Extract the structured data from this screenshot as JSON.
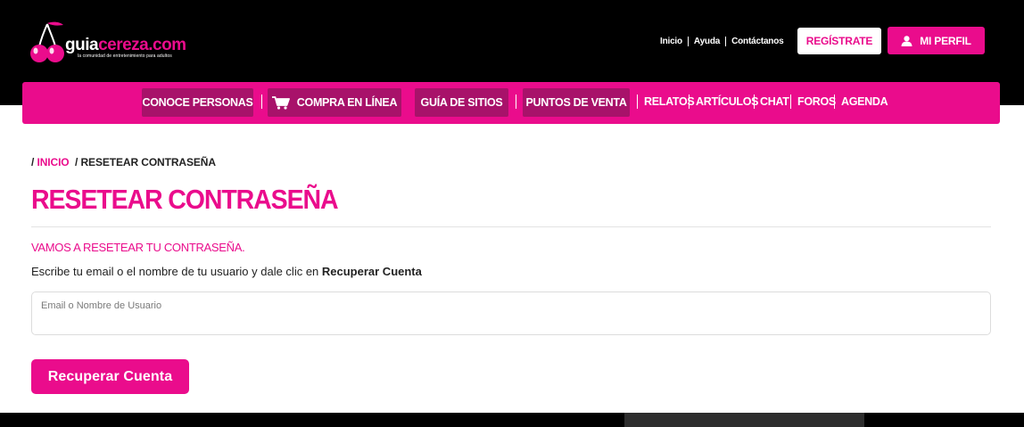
{
  "brand": {
    "name_part1": "guia",
    "name_part2": "cereza.com",
    "tagline": "la comunidad de entretenimiento para adultos",
    "accent_color": "#ea0c8c"
  },
  "top_links": [
    "Inicio",
    "Ayuda",
    "Contáctanos"
  ],
  "header_buttons": {
    "register": "REGÍSTRATE",
    "profile": "MI PERFIL",
    "profile_icon": "user-icon"
  },
  "nav": {
    "pills": [
      {
        "label": "CONOCE PERSONAS"
      },
      {
        "label": "COMPRA EN LÍNEA",
        "icon": "cart-icon"
      },
      {
        "label": "GUÍA DE SITIOS"
      },
      {
        "label": "PUNTOS DE VENTA"
      }
    ],
    "links": [
      "RELATOS",
      "ARTÍCULOS",
      "CHAT",
      "FOROS",
      "AGENDA"
    ]
  },
  "breadcrumb": {
    "home": "INICIO",
    "current": "RESETEAR CONTRASEÑA"
  },
  "page": {
    "title": "RESETEAR CONTRASEÑA",
    "subtitle": "VAMOS A RESETEAR TU CONTRASEÑA.",
    "instructions_prefix": "Escribe tu email o el nombre de tu usuario y dale clic en ",
    "instructions_bold": "Recuperar Cuenta"
  },
  "form": {
    "input_placeholder": "Email o Nombre de Usuario",
    "input_value": "",
    "submit_label": "Recuperar Cuenta"
  }
}
